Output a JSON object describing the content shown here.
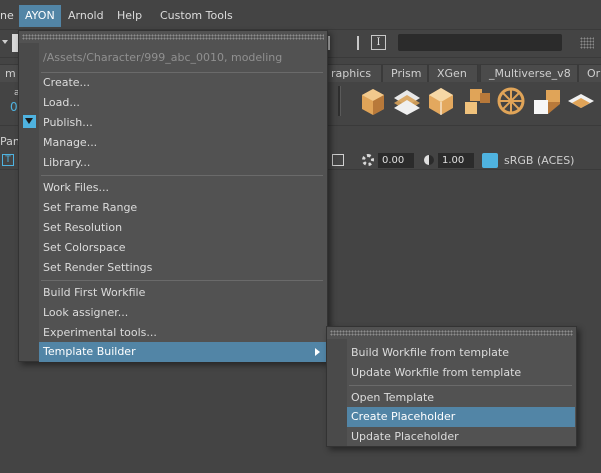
{
  "menubar": {
    "items": [
      "ne",
      "AYON",
      "Arnold",
      "Help",
      "Custom Tools"
    ],
    "active_index": 1
  },
  "shelf": {
    "tabs": [
      "m",
      "raphics",
      "Prism",
      "XGen",
      "_Multiverse_v8",
      "Or"
    ],
    "icon_names": [
      "cube-icon",
      "nurbs-grid-icon",
      "sphere-icon",
      "squares-icon",
      "wheel-icon",
      "split-box-icon",
      "plane-stack-icon"
    ]
  },
  "panel": {
    "menu_fragment": "Pan",
    "gamma_value": "0.00",
    "exposure_value": "1.00",
    "color_space": "sRGB (ACES)",
    "left_fragment_1": "a",
    "left_fragment_2": "0"
  },
  "ayon_menu": {
    "context_path": "/Assets/Character/999_abc_0010, modeling",
    "groups": [
      [
        "Create...",
        "Load...",
        "Publish...",
        "Manage...",
        "Library..."
      ],
      [
        "Work Files...",
        "Set Frame Range",
        "Set Resolution",
        "Set Colorspace",
        "Set Render Settings"
      ],
      [
        "Build First Workfile",
        "Look assigner...",
        "Experimental tools...",
        "Template Builder"
      ]
    ]
  },
  "template_submenu": {
    "groups": [
      [
        "Build Workfile from template",
        "Update Workfile from template"
      ],
      [
        "Open Template",
        "Create Placeholder",
        "Update Placeholder"
      ]
    ],
    "highlighted": "Create Placeholder"
  },
  "colors": {
    "highlight": "#5285a6",
    "background": "#444444",
    "menu_bg": "#525252",
    "accent_orange": "#e0a458"
  }
}
